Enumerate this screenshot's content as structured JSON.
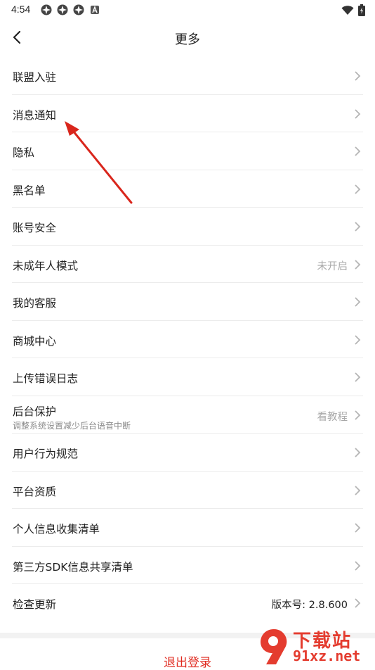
{
  "status_bar": {
    "time": "4:54",
    "icons": [
      "app-notification-icon",
      "app-notification-icon",
      "app-notification-icon",
      "a-notification-icon"
    ],
    "right_icons": [
      "wifi-icon",
      "battery-icon"
    ]
  },
  "header": {
    "title": "更多",
    "back_icon": "back-arrow-icon"
  },
  "settings": {
    "items": [
      {
        "label": "联盟入驻",
        "value": "",
        "sub": ""
      },
      {
        "label": "消息通知",
        "value": "",
        "sub": ""
      },
      {
        "label": "隐私",
        "value": "",
        "sub": ""
      },
      {
        "label": "黑名单",
        "value": "",
        "sub": ""
      },
      {
        "label": "账号安全",
        "value": "",
        "sub": ""
      },
      {
        "label": "未成年人模式",
        "value": "未开启",
        "sub": ""
      },
      {
        "label": "我的客服",
        "value": "",
        "sub": ""
      },
      {
        "label": "商城中心",
        "value": "",
        "sub": ""
      },
      {
        "label": "上传错误日志",
        "value": "",
        "sub": ""
      },
      {
        "label": "后台保护",
        "value": "看教程",
        "sub": "调整系统设置减少后台语音中断"
      },
      {
        "label": "用户行为规范",
        "value": "",
        "sub": ""
      },
      {
        "label": "平台资质",
        "value": "",
        "sub": ""
      },
      {
        "label": "个人信息收集清单",
        "value": "",
        "sub": ""
      },
      {
        "label": "第三方SDK信息共享清单",
        "value": "",
        "sub": ""
      },
      {
        "label": "检查更新",
        "value": "版本号: 2.8.600",
        "sub": ""
      }
    ]
  },
  "footer": {
    "logout_label": "退出登录"
  },
  "watermark": {
    "title": "下载站",
    "url": "91xz.net"
  },
  "colors": {
    "accent": "#e02b20",
    "arrow": "#d9261c",
    "muted": "#a8a8a8",
    "divider": "#ececec"
  }
}
